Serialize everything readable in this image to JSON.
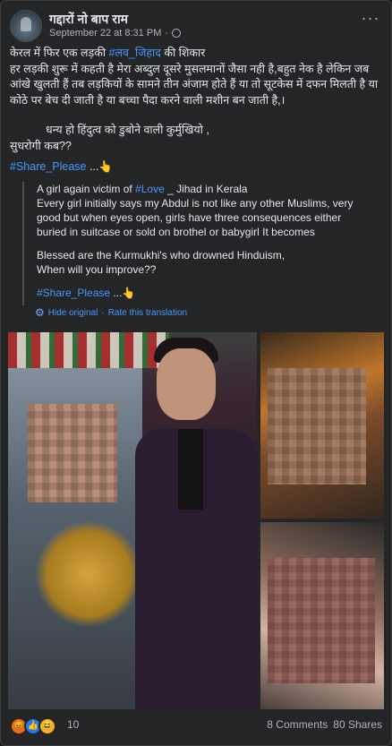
{
  "post": {
    "page_name": "गद्दारों नो बाप राम",
    "timestamp": "September 22 at 8:31 PM",
    "separator": "·",
    "more_label": "···",
    "lines": {
      "l1_pre": "केरल में फिर एक लड़की ",
      "l1_tag": "#लव_जिहाद",
      "l1_post": "  की शिकार",
      "l2": "हर लड़की शुरू में कहती है मेरा अब्दुल दूसरे मुसलमानों जैसा नही है,बहुत नेक है लेकिन जब आंखे खुलती हैं तब लड़कियों के सामने तीन अंजाम होते हैं या तो सूटकेस में दफन मिलती है या कोठे पर बेच दी जाती है या बच्चा पैदा करने वाली मशीन बन जाती है,।",
      "l3a": "धन्य हो हिंदुत्व को डुबोने वाली कुर्मुखियो ,",
      "l3b": "सुधरोगी कब??",
      "hashtag": "#Share_Please",
      "hashtag_suffix": " ...👆"
    }
  },
  "translation": {
    "p1_pre": "A girl again victim of ",
    "p1_tag": "#Love",
    "p1_post": " _ Jihad in Kerala",
    "p1_rest": "Every girl initially says my Abdul is not like any other Muslims, very good but when eyes open, girls have three consequences either buried in suitcase or sold on brothel or babygirl It becomes",
    "p2a": "Blessed are the Kurmukhi's who drowned Hinduism,",
    "p2b": "When will you improve??",
    "hashtag": "#Share_Please",
    "hashtag_suffix": " ...👆",
    "hide_label": "Hide original",
    "dot": "·",
    "rate_label": "Rate this translation"
  },
  "footer": {
    "reaction_count": "10",
    "comments": "8 Comments",
    "shares": "80 Shares"
  },
  "icons": {
    "avatar": "page-avatar",
    "globe": "globe-icon",
    "more": "more-options-icon",
    "gear": "gear-icon",
    "reactions": [
      "angry-reaction-icon",
      "like-reaction-icon",
      "haha-reaction-icon"
    ]
  },
  "colors": {
    "background": "#18191a",
    "card": "#242526",
    "link": "#4599ff",
    "text": "#e4e6eb",
    "muted": "#b0b3b8"
  }
}
